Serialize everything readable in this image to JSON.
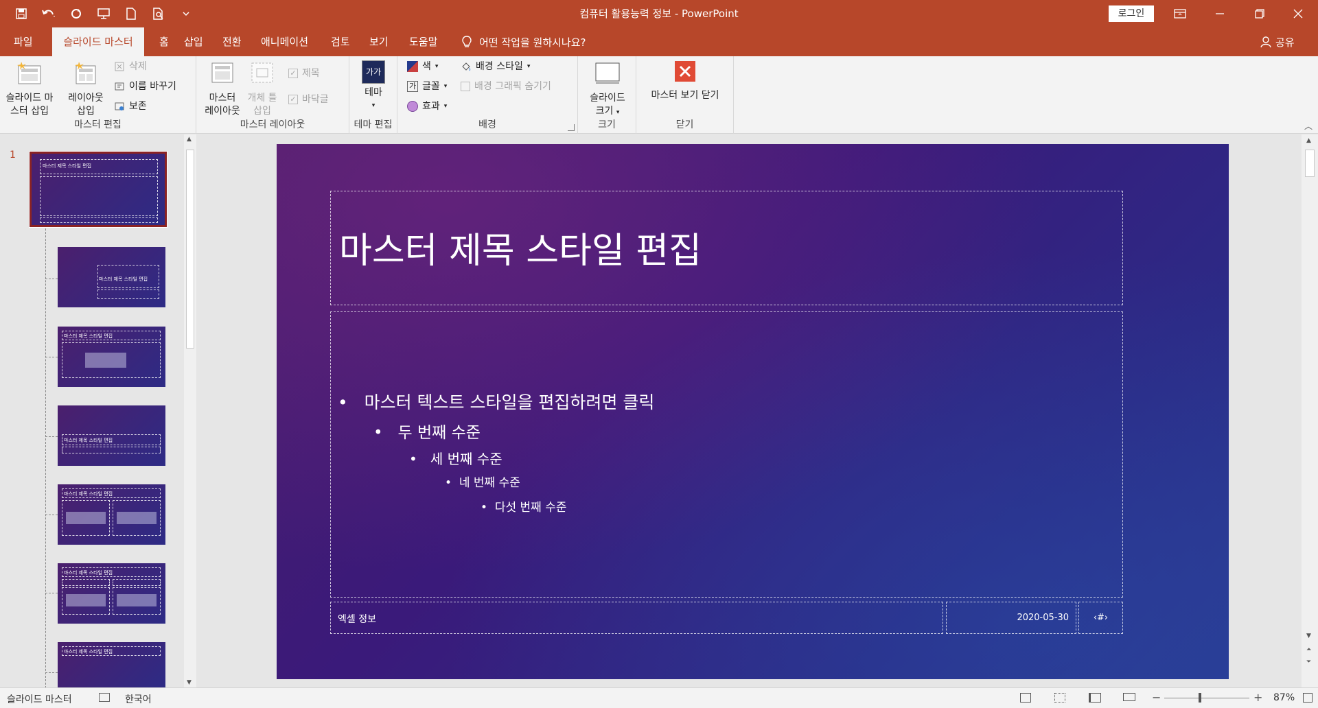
{
  "window": {
    "title": "컴퓨터 활용능력 정보  -  PowerPoint",
    "login_label": "로그인"
  },
  "tabs": [
    {
      "label": "파일"
    },
    {
      "label": "슬라이드 마스터"
    },
    {
      "label": "홈"
    },
    {
      "label": "삽입"
    },
    {
      "label": "전환"
    },
    {
      "label": "애니메이션"
    },
    {
      "label": "검토"
    },
    {
      "label": "보기"
    },
    {
      "label": "도움말"
    }
  ],
  "tell_me": "어떤 작업을 원하시나요?",
  "share": "공유",
  "ribbon": {
    "master_edit": {
      "label": "마스터 편집",
      "insert_master_line1": "슬라이드 마",
      "insert_master_line2": "스터 삽입",
      "insert_layout_line1": "레이아웃",
      "insert_layout_line2": "삽입",
      "delete": "삭제",
      "rename": "이름 바꾸기",
      "preserve": "보존"
    },
    "master_layout": {
      "label": "마스터 레이아웃",
      "master_layout_line1": "마스터",
      "master_layout_line2": "레이아웃",
      "insert_ph_line1": "개체 틀",
      "insert_ph_line2": "삽입",
      "title_check": "제목",
      "footer_check": "바닥글"
    },
    "theme_edit": {
      "label": "테마 편집",
      "theme": "테마",
      "theme_icon_text": "가가"
    },
    "background": {
      "label": "배경",
      "colors": "색",
      "fonts": "글꼴",
      "effects": "효과",
      "bg_styles": "배경 스타일",
      "hide_bg": "배경 그래픽 숨기기"
    },
    "size": {
      "label": "크기",
      "slide_size_line1": "슬라이드",
      "slide_size_line2": "크기"
    },
    "close": {
      "label": "닫기",
      "close_master": "마스터 보기 닫기"
    }
  },
  "thumbnails": {
    "slide_number": "1",
    "master_title": "마스터 제목 스타일 편집"
  },
  "slide": {
    "title": "마스터 제목 스타일 편집",
    "bullets": [
      "마스터 텍스트 스타일을 편집하려면 클릭",
      "두 번째 수준",
      "세 번째 수준",
      "네 번째 수준",
      "다섯 번째 수준"
    ],
    "footer": "엑셀 정보",
    "date": "2020-05-30",
    "number": "‹#›"
  },
  "status": {
    "view": "슬라이드 마스터",
    "language": "한국어",
    "zoom": "87%"
  },
  "colors": {
    "accent": "#b7472a",
    "close_red": "#e04a35"
  }
}
